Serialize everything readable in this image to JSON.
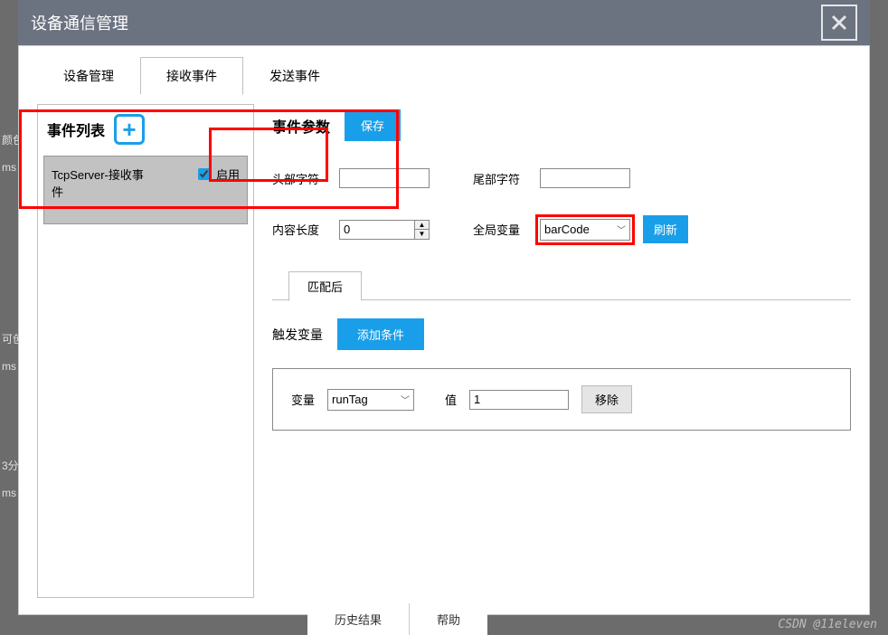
{
  "window": {
    "title": "设备通信管理"
  },
  "tabs": [
    "设备管理",
    "接收事件",
    "发送事件"
  ],
  "active_tab_index": 1,
  "event_list": {
    "title": "事件列表",
    "items": [
      {
        "name": "TcpServer-接收事件",
        "enable_label": "启用",
        "enabled": true
      }
    ]
  },
  "params": {
    "title": "事件参数",
    "save_label": "保存",
    "head_char_label": "头部字符",
    "head_char_value": "",
    "tail_char_label": "尾部字符",
    "tail_char_value": "",
    "content_len_label": "内容长度",
    "content_len_value": "0",
    "global_var_label": "全局变量",
    "global_var_value": "barCode",
    "refresh_label": "刷新"
  },
  "match": {
    "tab_label": "匹配后",
    "trigger_var_label": "触发变量",
    "add_cond_label": "添加条件",
    "condition": {
      "var_label": "变量",
      "var_value": "runTag",
      "value_label": "值",
      "value_value": "1",
      "remove_label": "移除"
    }
  },
  "bottom_tabs": [
    "历史结果",
    "帮助"
  ],
  "watermark": "CSDN @11eleven",
  "bg_fragments": {
    "a": "颜色",
    "b": "ms",
    "c": "可创",
    "d": "ms",
    "e": "3分",
    "f": "ms"
  }
}
